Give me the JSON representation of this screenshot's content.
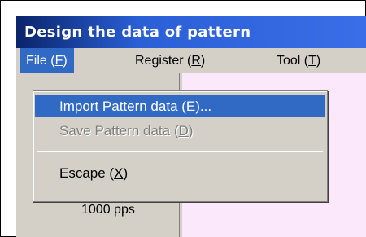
{
  "window": {
    "title": "Design the data of pattern"
  },
  "menubar": {
    "items": [
      {
        "label": "File (F)",
        "text": "File (",
        "key": "F",
        "tail": ")"
      },
      {
        "label": "Register (R)",
        "text": "Register (",
        "key": "R",
        "tail": ")"
      },
      {
        "label": "Tool (T)",
        "text": "Tool (",
        "key": "T",
        "tail": ")"
      }
    ]
  },
  "file_menu": {
    "items": [
      {
        "text": "Import Pattern data (",
        "key": "E",
        "tail": ")...",
        "state": "highlighted"
      },
      {
        "text": "Save Pattern data (",
        "key": "D",
        "tail": ")",
        "state": "disabled"
      },
      {
        "text": "Escape (",
        "key": "X",
        "tail": ")",
        "state": "normal"
      }
    ]
  },
  "background": {
    "partial_value": "00",
    "speed_label": "1000 pps"
  },
  "colors": {
    "title_bar": "#0a246a",
    "highlight": "#316ac5",
    "face": "#d4d0c8",
    "pink_pane": "#fbe9fb"
  }
}
